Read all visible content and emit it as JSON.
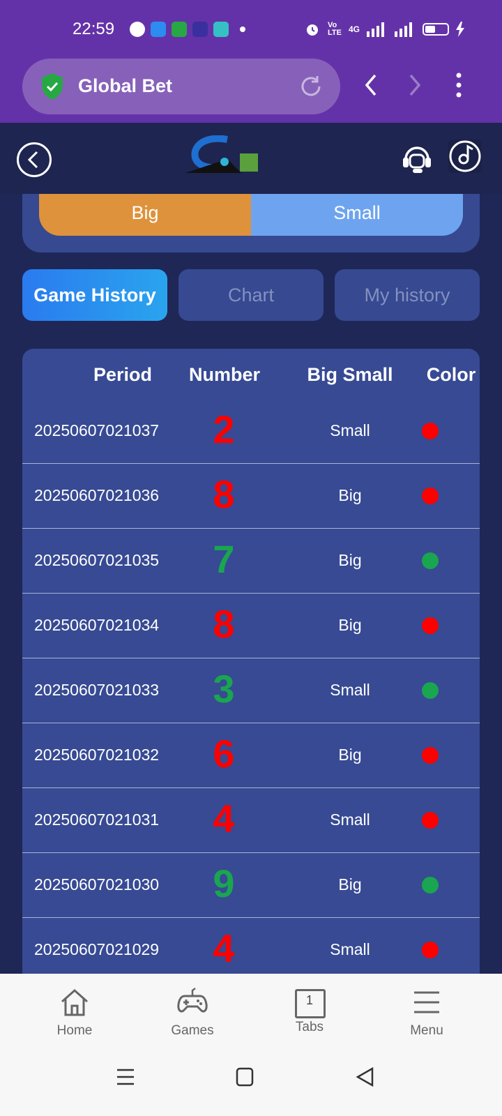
{
  "status": {
    "time": "22:59",
    "network": "4G"
  },
  "browser": {
    "url_title": "Global Bet"
  },
  "toggle": {
    "big": "Big",
    "small": "Small"
  },
  "tabs": [
    "Game History",
    "Chart",
    "My history"
  ],
  "table": {
    "headers": [
      "Period",
      "Number",
      "Big Small",
      "Color"
    ],
    "rows": [
      {
        "period": "20250607021037",
        "number": "2",
        "bs": "Small",
        "color": "#ff0000"
      },
      {
        "period": "20250607021036",
        "number": "8",
        "bs": "Big",
        "color": "#ff0000"
      },
      {
        "period": "20250607021035",
        "number": "7",
        "bs": "Big",
        "color": "#1aa550"
      },
      {
        "period": "20250607021034",
        "number": "8",
        "bs": "Big",
        "color": "#ff0000"
      },
      {
        "period": "20250607021033",
        "number": "3",
        "bs": "Small",
        "color": "#1aa550"
      },
      {
        "period": "20250607021032",
        "number": "6",
        "bs": "Big",
        "color": "#ff0000"
      },
      {
        "period": "20250607021031",
        "number": "4",
        "bs": "Small",
        "color": "#ff0000"
      },
      {
        "period": "20250607021030",
        "number": "9",
        "bs": "Big",
        "color": "#1aa550"
      },
      {
        "period": "20250607021029",
        "number": "4",
        "bs": "Small",
        "color": "#ff0000"
      }
    ]
  },
  "bottom_nav": {
    "home": "Home",
    "games": "Games",
    "tabs": "Tabs",
    "tabs_count": "1",
    "menu": "Menu"
  },
  "colors": {
    "status_bar": "#6432a8",
    "accent_orange": "#de923b",
    "accent_blue": "#6ea4ef",
    "red": "#ff0000",
    "green": "#1aa550"
  }
}
